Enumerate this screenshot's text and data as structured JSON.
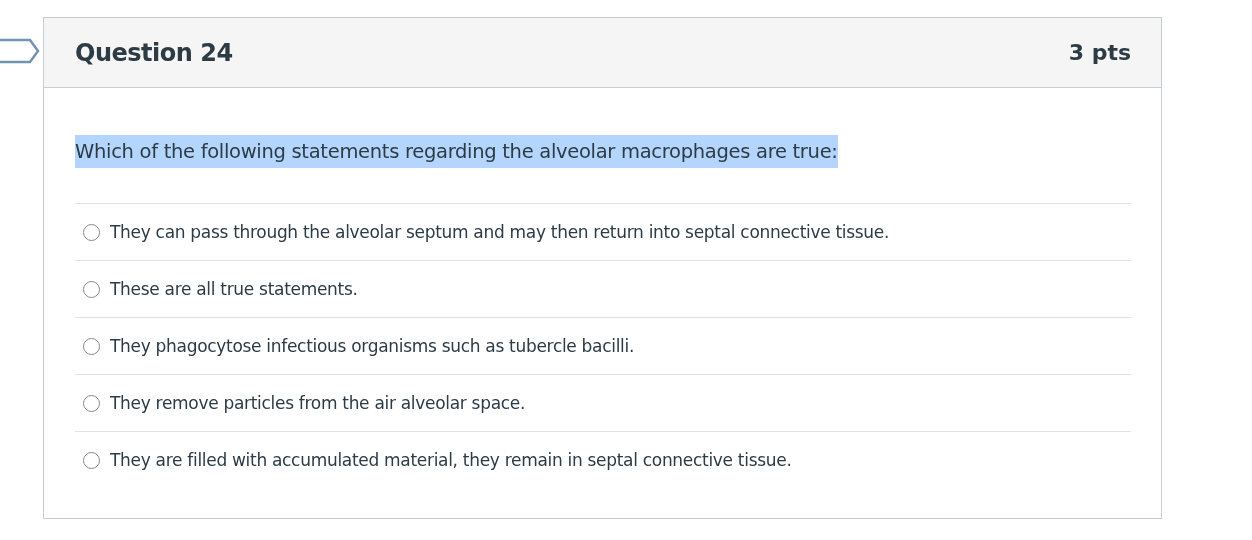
{
  "question": {
    "title": "Question 24",
    "points": "3 pts",
    "text": "Which of the following statements regarding the alveolar macrophages are true:",
    "highlighted": true,
    "answers": [
      {
        "label": "They can pass through the alveolar septum and may then return into septal connective tissue.",
        "selected": false
      },
      {
        "label": "These are all true statements.",
        "selected": false
      },
      {
        "label": "They phagocytose infectious organisms such as tubercle bacilli.",
        "selected": false
      },
      {
        "label": "They remove particles from the air alveolar space.",
        "selected": false
      },
      {
        "label": "They are filled with accumulated material, they remain in septal connective tissue.",
        "selected": false
      }
    ]
  }
}
